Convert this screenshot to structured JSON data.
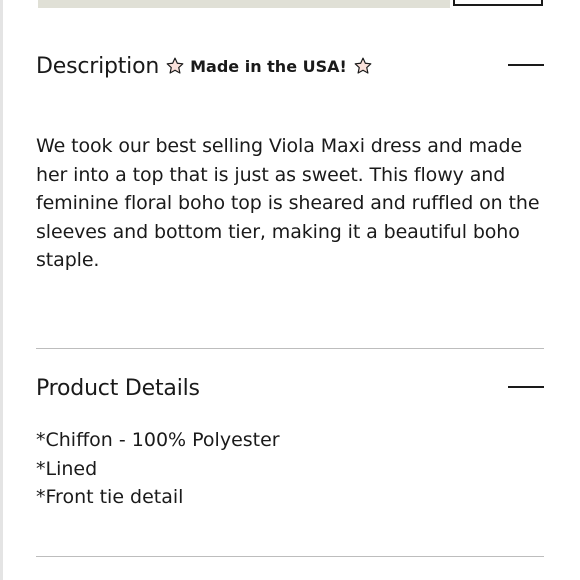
{
  "description": {
    "title": "Description",
    "badge_text": "Made in the USA!",
    "badge_icon": "star-outline-icon",
    "star_color": "#e59a8c",
    "body": "We took our best selling Viola Maxi dress and made her into a top that is just as sweet. This flowy and feminine floral boho top is sheared and ruffled on the sleeves and bottom tier, making it a beautiful boho staple."
  },
  "product_details": {
    "title": "Product Details",
    "items": [
      "*Chiffon - 100% Polyester",
      "*Lined",
      "*Front tie detail"
    ]
  }
}
